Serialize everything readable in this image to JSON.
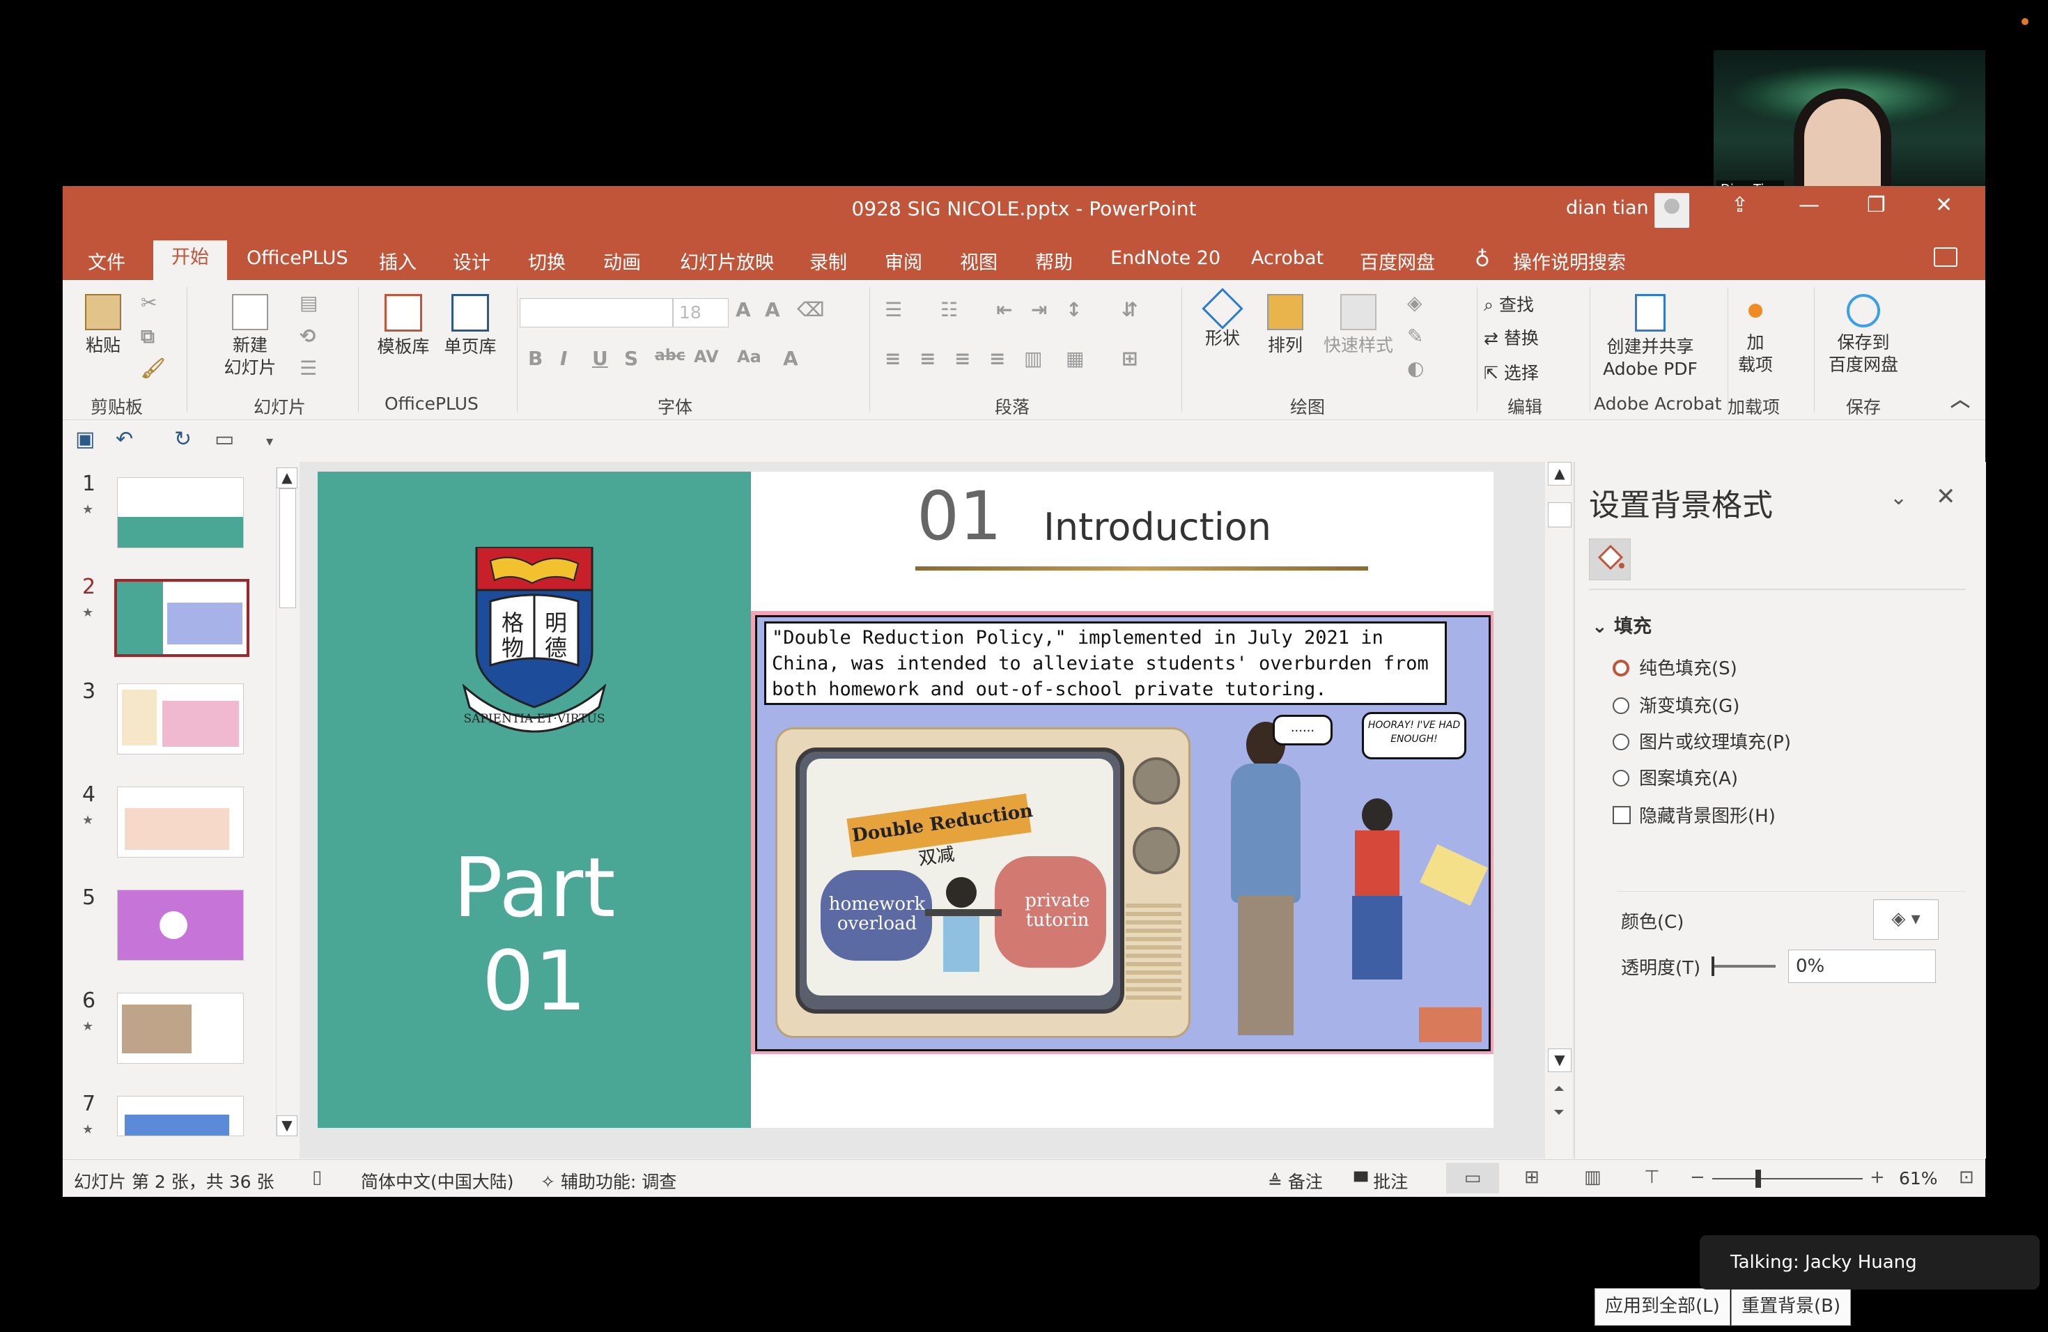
{
  "video": {
    "participant_name": "Dian Tian"
  },
  "window": {
    "title": "0928 SIG NICOLE.pptx  -  PowerPoint",
    "user_name": "dian tian"
  },
  "tabs": [
    "文件",
    "开始",
    "OfficePLUS",
    "插入",
    "设计",
    "切换",
    "动画",
    "幻灯片放映",
    "录制",
    "审阅",
    "视图",
    "帮助",
    "EndNote 20",
    "Acrobat",
    "百度网盘"
  ],
  "active_tab": "开始",
  "tell_me": "操作说明搜索",
  "ribbon": {
    "paste": "粘贴",
    "clipboard_group": "剪贴板",
    "new_slide_1": "新建",
    "new_slide_2": "幻灯片",
    "slides_group": "幻灯片",
    "template_lib": "模板库",
    "single_page_lib": "单页库",
    "officeplus_group": "OfficePLUS",
    "font_size": "18",
    "font_group": "字体",
    "paragraph_group": "段落",
    "shapes": "形状",
    "arrange": "排列",
    "quick_styles": "快速样式",
    "drawing_group": "绘图",
    "find": "查找",
    "replace": "替换",
    "select": "选择",
    "editing_group": "编辑",
    "create_share_1": "创建并共享",
    "create_share_2": "Adobe PDF",
    "adobe_group": "Adobe Acrobat",
    "addins_1": "加",
    "addins_2": "载项",
    "addins_group": "加载项",
    "save_baidu_1": "保存到",
    "save_baidu_2": "百度网盘",
    "save_group": "保存"
  },
  "thumbnails": [
    {
      "num": "1",
      "bg": "#4aa795"
    },
    {
      "num": "2",
      "bg": "#4aa795"
    },
    {
      "num": "3",
      "bg": "#f6e7c8"
    },
    {
      "num": "4",
      "bg": "#f7d9c9"
    },
    {
      "num": "5",
      "bg": "#c774d8"
    },
    {
      "num": "6",
      "bg": "#ffffff"
    },
    {
      "num": "7",
      "bg": "#5b8bd8"
    }
  ],
  "slide": {
    "part_line1": "Part",
    "part_line2": "01",
    "section_number": "01",
    "section_title": "Introduction",
    "quote": "\"Double Reduction Policy,\" implemented in July 2021 in China, was intended to alleviate students' overburden from both homework and out-of-school private tutoring.",
    "sign_text": "Double Reduction",
    "sign_cn": "双减",
    "roll_left": "homework overload",
    "roll_right": "private tutorin",
    "bubble1": "......",
    "bubble2": "HOORAY! I'VE HAD ENOUGH!",
    "crest_motto": "SAPIENTIA·ET·VIRTUS",
    "crest_chars": "格 明 物 德"
  },
  "pane": {
    "title": "设置背景格式",
    "fill_header": "填充",
    "options": [
      "纯色填充(S)",
      "渐变填充(G)",
      "图片或纹理填充(P)",
      "图案填充(A)"
    ],
    "hide_bg": "隐藏背景图形(H)",
    "color_label": "颜色(C)",
    "transparency_label": "透明度(T)",
    "transparency_value": "0%",
    "apply_all": "应用到全部(L)",
    "reset_bg": "重置背景(B)"
  },
  "status": {
    "slide_info": "幻灯片 第 2 张，共 36 张",
    "language": "简体中文(中国大陆)",
    "accessibility": "辅助功能: 调查",
    "notes": "备注",
    "comments": "批注",
    "zoom": "61%"
  },
  "talking": "Talking: Jacky Huang",
  "colors": {
    "accent": "#c0553a",
    "slide_green": "#4aa795"
  }
}
